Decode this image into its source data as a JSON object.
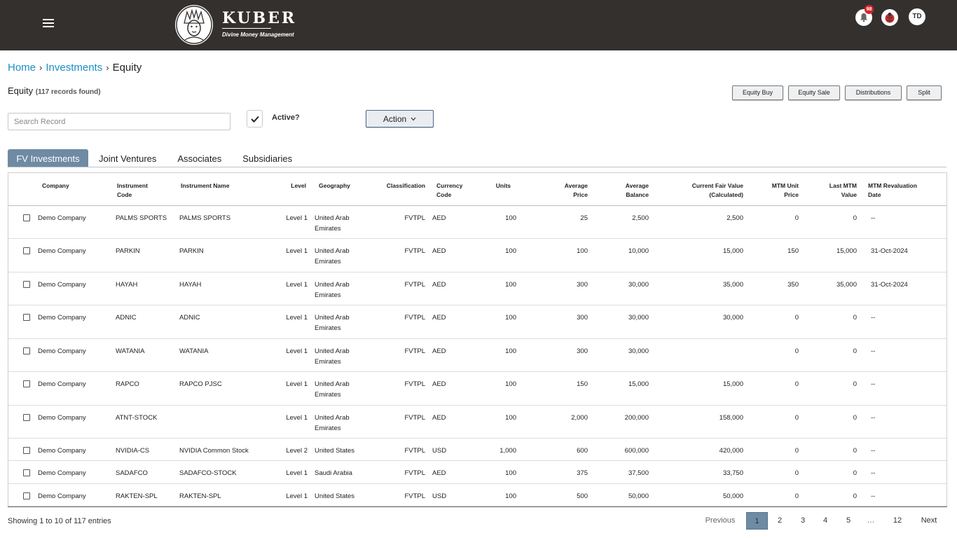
{
  "header": {
    "logo_title": "KUBER",
    "logo_tagline": "Divine Money Management",
    "notification_count": "98",
    "user_initials": "TD"
  },
  "breadcrumb": {
    "items": [
      "Home",
      "Investments"
    ],
    "current": "Equity"
  },
  "page": {
    "title": "Equity",
    "records_found": "(117 records found)"
  },
  "actions": {
    "equity_buy": "Equity Buy",
    "equity_sale": "Equity Sale",
    "distributions": "Distributions",
    "split": "Split",
    "action": "Action"
  },
  "search": {
    "placeholder": "Search Record",
    "value": ""
  },
  "filter": {
    "active_label": "Active?",
    "active_checked": true
  },
  "tabs": [
    "FV Investments",
    "Joint Ventures",
    "Associates",
    "Subsidiaries"
  ],
  "table": {
    "headers": {
      "company": "Company",
      "instrument_code_1": "Instrument",
      "instrument_code_2": "Code",
      "instrument_name": "Instrument Name",
      "level": "Level",
      "geography": "Geography",
      "classification": "Classification",
      "currency_1": "Currency",
      "currency_2": "Code",
      "units": "Units",
      "avg_price_1": "Average",
      "avg_price_2": "Price",
      "avg_balance_1": "Average",
      "avg_balance_2": "Balance",
      "cfv_1": "Current Fair Value",
      "cfv_2": "(Calculated)",
      "mtm_unit_1": "MTM Unit",
      "mtm_unit_2": "Price",
      "last_mtm_1": "Last MTM",
      "last_mtm_2": "Value",
      "mtm_date_1": "MTM Revaluation",
      "mtm_date_2": "Date"
    },
    "rows": [
      {
        "company": "Demo Company",
        "code": "PALMS SPORTS",
        "name": "PALMS SPORTS",
        "level": "Level 1",
        "geo1": "United Arab",
        "geo2": "Emirates",
        "class": "FVTPL",
        "ccy": "AED",
        "units": "100",
        "avg_price": "25",
        "avg_balance": "2,500",
        "cfv": "2,500",
        "mtm_unit": "0",
        "last_mtm": "0",
        "mtm_date": "--"
      },
      {
        "company": "Demo Company",
        "code": "PARKIN",
        "name": "PARKIN",
        "level": "Level 1",
        "geo1": "United Arab",
        "geo2": "Emirates",
        "class": "FVTPL",
        "ccy": "AED",
        "units": "100",
        "avg_price": "100",
        "avg_balance": "10,000",
        "cfv": "15,000",
        "mtm_unit": "150",
        "last_mtm": "15,000",
        "mtm_date": "31-Oct-2024"
      },
      {
        "company": "Demo Company",
        "code": "HAYAH",
        "name": "HAYAH",
        "level": "Level 1",
        "geo1": "United Arab",
        "geo2": "Emirates",
        "class": "FVTPL",
        "ccy": "AED",
        "units": "100",
        "avg_price": "300",
        "avg_balance": "30,000",
        "cfv": "35,000",
        "mtm_unit": "350",
        "last_mtm": "35,000",
        "mtm_date": "31-Oct-2024"
      },
      {
        "company": "Demo Company",
        "code": "ADNIC",
        "name": "ADNIC",
        "level": "Level 1",
        "geo1": "United Arab",
        "geo2": "Emirates",
        "class": "FVTPL",
        "ccy": "AED",
        "units": "100",
        "avg_price": "300",
        "avg_balance": "30,000",
        "cfv": "30,000",
        "mtm_unit": "0",
        "last_mtm": "0",
        "mtm_date": "--"
      },
      {
        "company": "Demo Company",
        "code": "WATANIA",
        "name": "WATANIA",
        "level": "Level 1",
        "geo1": "United Arab",
        "geo2": "Emirates",
        "class": "FVTPL",
        "ccy": "AED",
        "units": "100",
        "avg_price": "300",
        "avg_balance": "30,000",
        "cfv": "",
        "mtm_unit": "0",
        "last_mtm": "0",
        "mtm_date": "--"
      },
      {
        "company": "Demo Company",
        "code": "RAPCO",
        "name": "RAPCO PJSC",
        "level": "Level 1",
        "geo1": "United Arab",
        "geo2": "Emirates",
        "class": "FVTPL",
        "ccy": "AED",
        "units": "100",
        "avg_price": "150",
        "avg_balance": "15,000",
        "cfv": "15,000",
        "mtm_unit": "0",
        "last_mtm": "0",
        "mtm_date": "--"
      },
      {
        "company": "Demo Company",
        "code": "ATNT-STOCK",
        "name": "",
        "level": "Level 1",
        "geo1": "United Arab",
        "geo2": "Emirates",
        "class": "FVTPL",
        "ccy": "AED",
        "units": "100",
        "avg_price": "2,000",
        "avg_balance": "200,000",
        "cfv": "158,000",
        "mtm_unit": "0",
        "last_mtm": "0",
        "mtm_date": "--"
      },
      {
        "company": "Demo Company",
        "code": "NVIDIA-CS",
        "name": "NVIDIA Common Stock",
        "level": "Level 2",
        "geo1": "United States",
        "geo2": "",
        "class": "FVTPL",
        "ccy": "USD",
        "units": "1,000",
        "avg_price": "600",
        "avg_balance": "600,000",
        "cfv": "420,000",
        "mtm_unit": "0",
        "last_mtm": "0",
        "mtm_date": "--"
      },
      {
        "company": "Demo Company",
        "code": "SADAFCO",
        "name": "SADAFCO-STOCK",
        "level": "Level 1",
        "geo1": "Saudi Arabia",
        "geo2": "",
        "class": "FVTPL",
        "ccy": "AED",
        "units": "100",
        "avg_price": "375",
        "avg_balance": "37,500",
        "cfv": "33,750",
        "mtm_unit": "0",
        "last_mtm": "0",
        "mtm_date": "--"
      },
      {
        "company": "Demo Company",
        "code": "RAKTEN-SPL",
        "name": "RAKTEN-SPL",
        "level": "Level 1",
        "geo1": "United States",
        "geo2": "",
        "class": "FVTPL",
        "ccy": "USD",
        "units": "100",
        "avg_price": "500",
        "avg_balance": "50,000",
        "cfv": "50,000",
        "mtm_unit": "0",
        "last_mtm": "0",
        "mtm_date": "--"
      }
    ]
  },
  "footer": {
    "showing": "Showing 1 to 10 of 117 entries",
    "previous": "Previous",
    "pages": [
      "1",
      "2",
      "3",
      "4",
      "5",
      "…",
      "12"
    ],
    "next": "Next",
    "current_page": "1"
  },
  "colors": {
    "topbar": "#33302d",
    "link": "#1a8fc7",
    "tab_active": "#6e8ba3",
    "badge": "#d9242b"
  },
  "icons": {
    "menu": "hamburger-icon",
    "notifications": "bell-icon",
    "bug": "ladybug-icon",
    "check": "checkmark-icon",
    "chevron": "chevron-down-icon"
  }
}
